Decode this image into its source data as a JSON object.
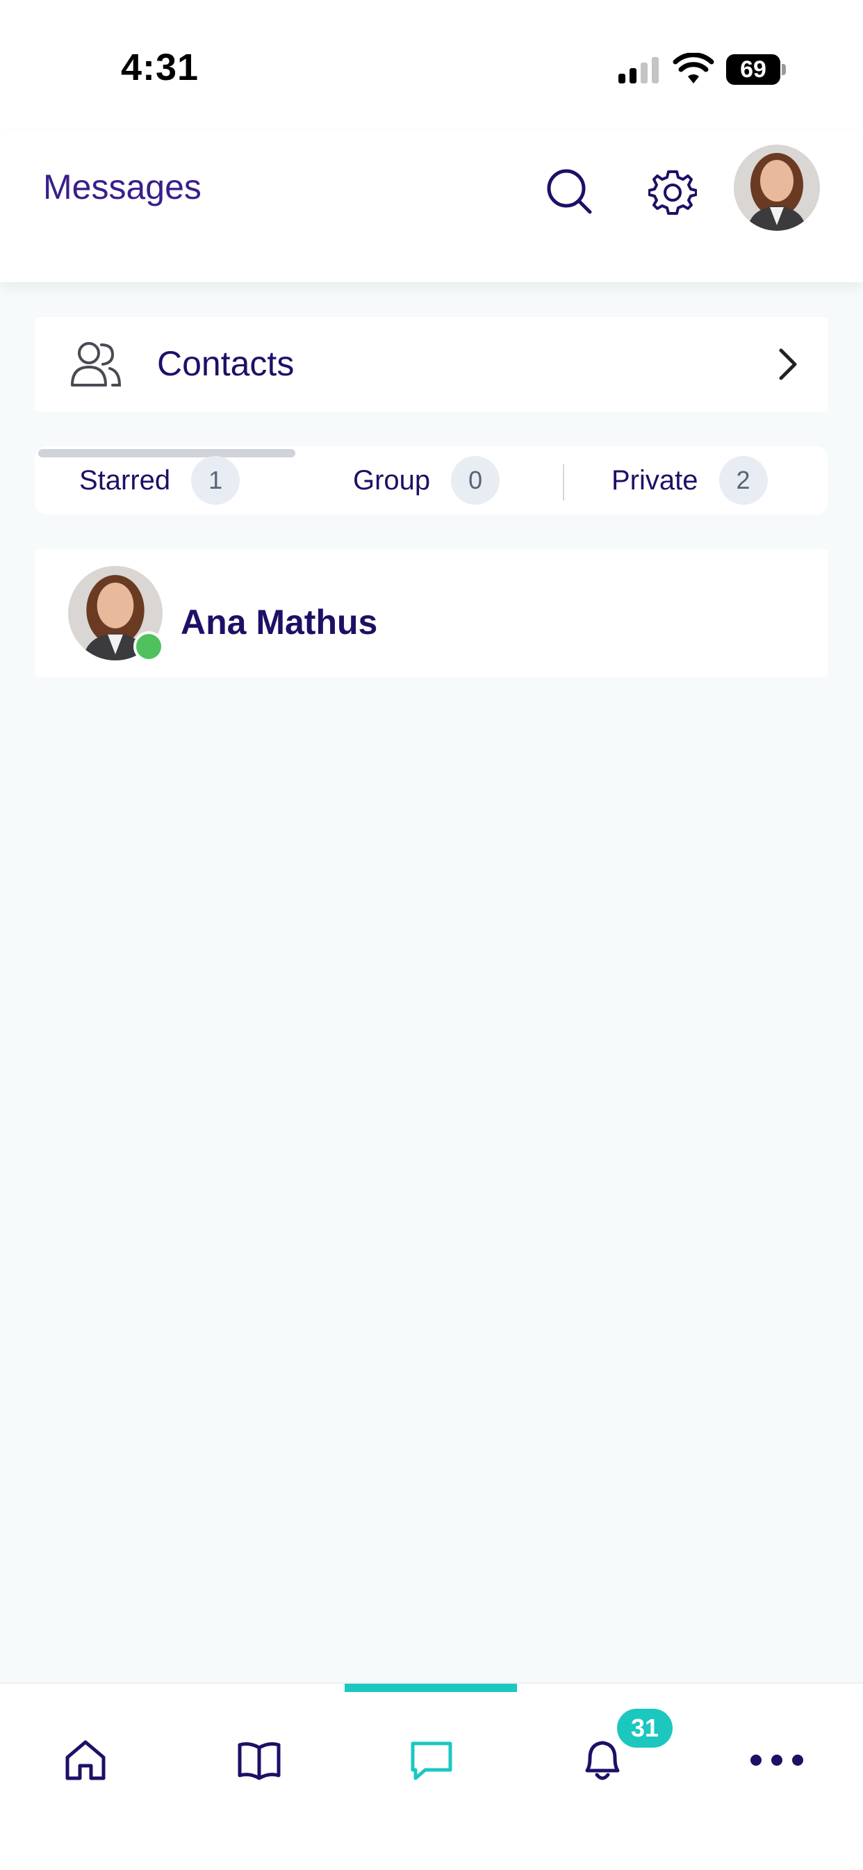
{
  "status_bar": {
    "time": "4:31",
    "battery": "69"
  },
  "header": {
    "title": "Messages",
    "search_icon": "search-icon",
    "settings_icon": "gear-icon",
    "avatar": "user-avatar"
  },
  "contacts": {
    "label": "Contacts",
    "icon": "users-icon",
    "chevron": "chevron-right-icon"
  },
  "tabs": [
    {
      "label": "Starred",
      "count": "1"
    },
    {
      "label": "Group",
      "count": "0"
    },
    {
      "label": "Private",
      "count": "2"
    }
  ],
  "conversations": [
    {
      "name": "Ana Mathus",
      "online": true
    }
  ],
  "bottom_nav": {
    "items": [
      "home-icon",
      "book-icon",
      "chat-icon",
      "bell-icon",
      "more-icon"
    ],
    "active": "chat-icon",
    "notification_badge": "31"
  },
  "colors": {
    "primary": "#1f0f66",
    "accent": "#1cc7bf",
    "online": "#4fc25d",
    "background": "#f6fafb"
  }
}
